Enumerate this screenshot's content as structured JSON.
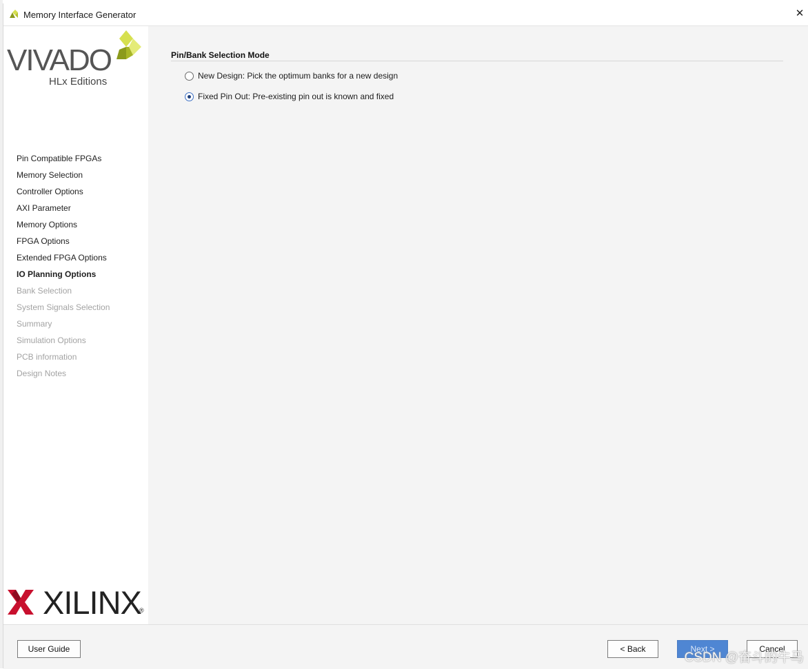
{
  "window": {
    "title": "Memory Interface Generator",
    "close_glyph": "✕"
  },
  "branding": {
    "vivado_text": "VIVADO",
    "vivado_dot": ".",
    "edition_text": "HLx Editions",
    "xilinx_text": "XILINX",
    "xilinx_reg": "®"
  },
  "sidebar": {
    "items": [
      {
        "label": "Pin Compatible FPGAs",
        "state": "done"
      },
      {
        "label": "Memory Selection",
        "state": "done"
      },
      {
        "label": "Controller Options",
        "state": "done"
      },
      {
        "label": "AXI Parameter",
        "state": "done"
      },
      {
        "label": "Memory Options",
        "state": "done"
      },
      {
        "label": "FPGA Options",
        "state": "done"
      },
      {
        "label": "Extended FPGA Options",
        "state": "done"
      },
      {
        "label": "IO Planning Options",
        "state": "active"
      },
      {
        "label": "Bank Selection",
        "state": "disabled"
      },
      {
        "label": "System Signals Selection",
        "state": "disabled"
      },
      {
        "label": "Summary",
        "state": "disabled"
      },
      {
        "label": "Simulation Options",
        "state": "disabled"
      },
      {
        "label": "PCB information",
        "state": "disabled"
      },
      {
        "label": "Design Notes",
        "state": "disabled"
      }
    ]
  },
  "main": {
    "section_title": "Pin/Bank Selection Mode",
    "options": [
      {
        "label": "New Design: Pick the optimum banks for a new design",
        "checked": false
      },
      {
        "label": "Fixed Pin Out: Pre-existing pin out is known and fixed",
        "checked": true
      }
    ]
  },
  "footer": {
    "user_guide": "User Guide",
    "back": "< Back",
    "next": "Next >",
    "cancel": "Cancel"
  },
  "watermark": "CSDN @奋斗的牛马",
  "colors": {
    "accent": "#4f86d3",
    "vivado_leaf_light": "#d6e04f",
    "vivado_leaf_dark": "#8b9a1c",
    "xilinx_red": "#c8102e"
  }
}
